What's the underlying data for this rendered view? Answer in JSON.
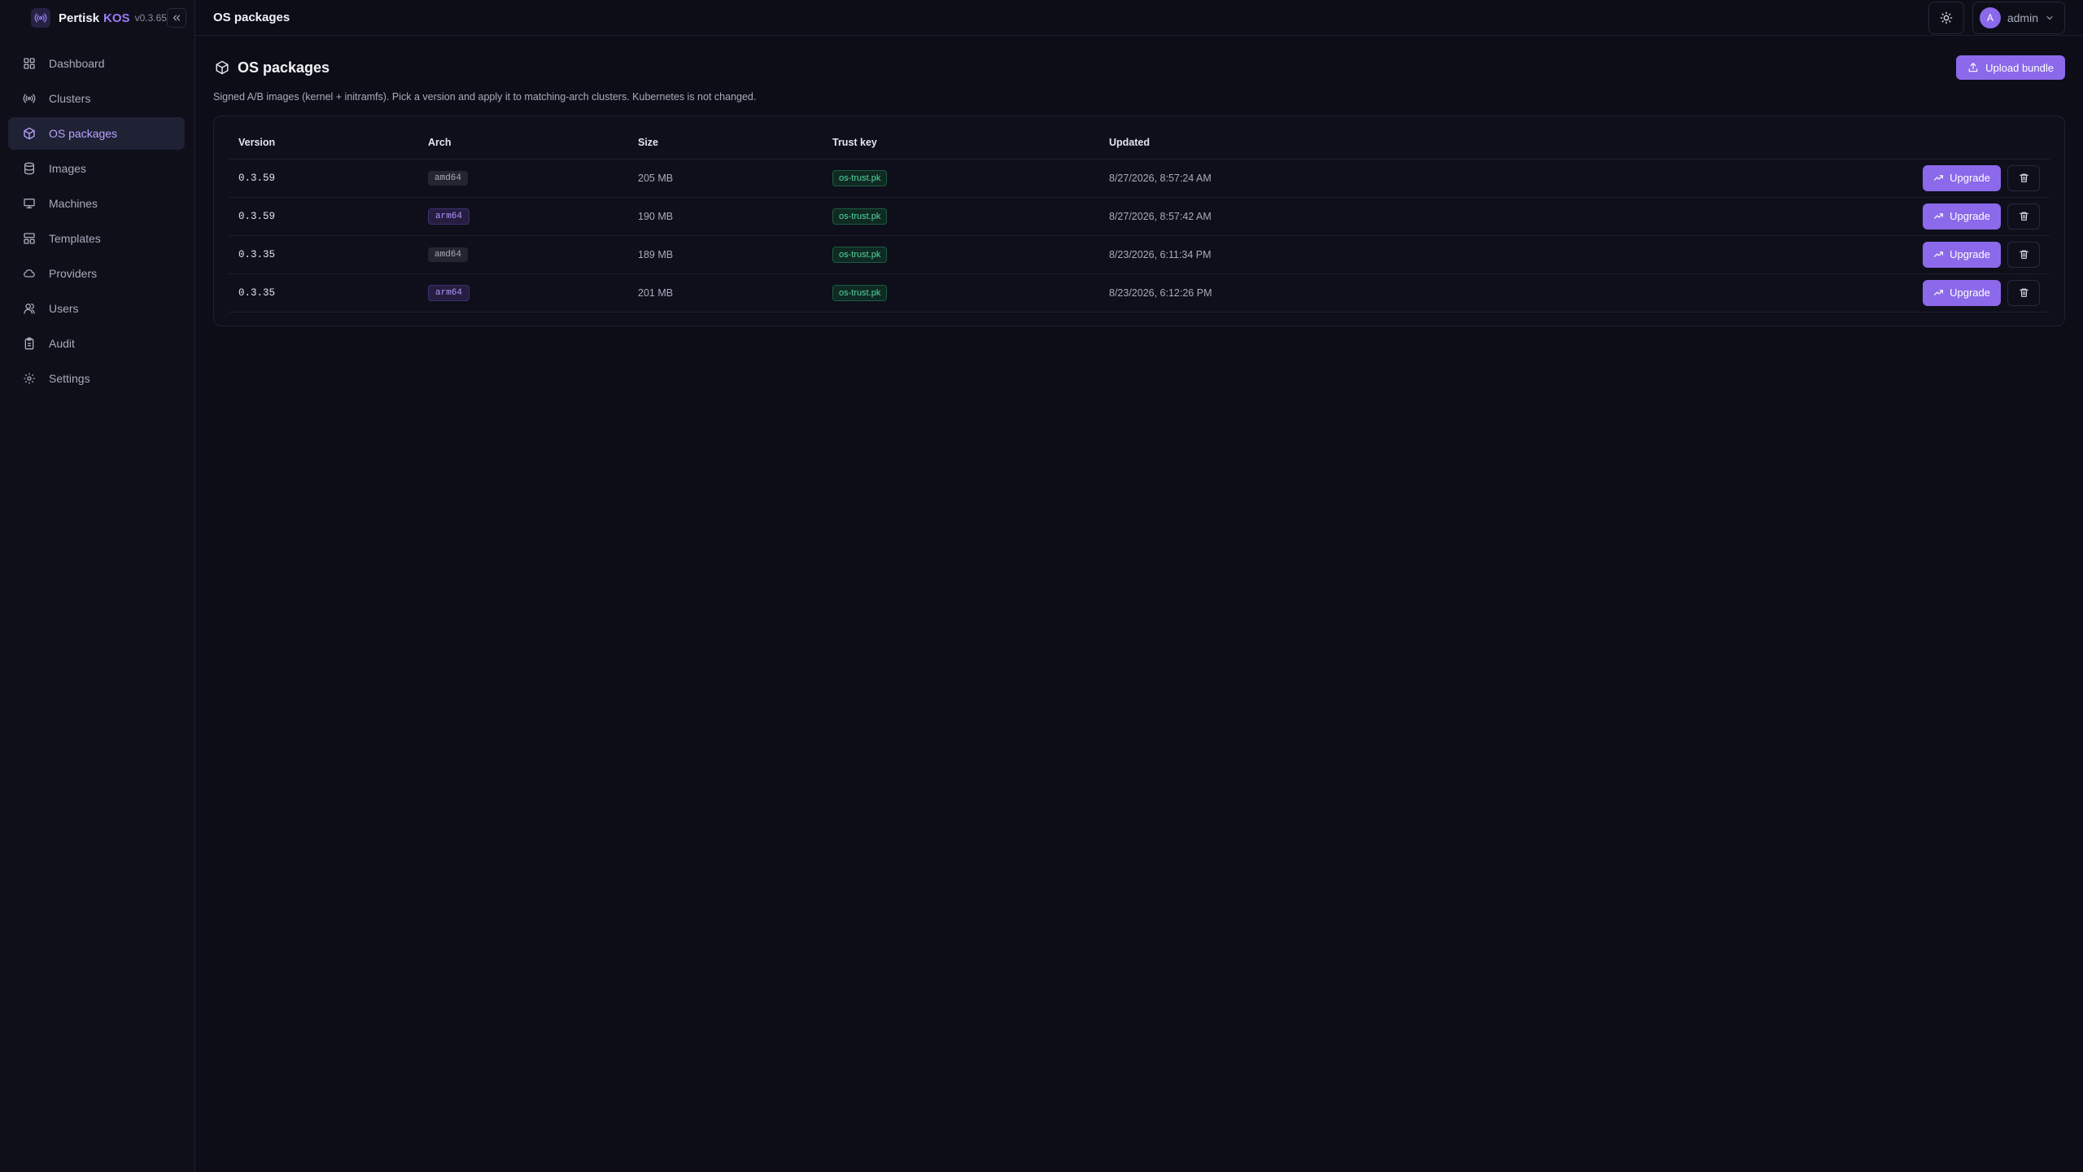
{
  "brand": {
    "name": "Pertisk",
    "accent": "KOS",
    "version": "v0.3.65"
  },
  "sidebar": {
    "items": [
      {
        "label": "Dashboard",
        "icon": "grid-icon"
      },
      {
        "label": "Clusters",
        "icon": "broadcast-icon"
      },
      {
        "label": "OS packages",
        "icon": "package-icon",
        "active": true
      },
      {
        "label": "Images",
        "icon": "database-icon"
      },
      {
        "label": "Machines",
        "icon": "monitor-icon"
      },
      {
        "label": "Templates",
        "icon": "layout-icon"
      },
      {
        "label": "Providers",
        "icon": "cloud-icon"
      },
      {
        "label": "Users",
        "icon": "users-icon"
      },
      {
        "label": "Audit",
        "icon": "clipboard-icon"
      },
      {
        "label": "Settings",
        "icon": "gear-icon"
      }
    ]
  },
  "topbar": {
    "title": "OS packages",
    "user": {
      "initial": "A",
      "name": "admin"
    }
  },
  "page": {
    "title": "OS packages",
    "description": "Signed A/B images (kernel + initramfs). Pick a version and apply it to matching-arch clusters. Kubernetes is not changed.",
    "upload_label": "Upload bundle"
  },
  "table": {
    "headers": {
      "version": "Version",
      "arch": "Arch",
      "size": "Size",
      "trust": "Trust key",
      "updated": "Updated"
    },
    "upgrade_label": "Upgrade",
    "rows": [
      {
        "version": "0.3.59",
        "arch": "amd64",
        "size": "205 MB",
        "trust": "os-trust.pk",
        "updated": "8/27/2026, 8:57:24 AM"
      },
      {
        "version": "0.3.59",
        "arch": "arm64",
        "size": "190 MB",
        "trust": "os-trust.pk",
        "updated": "8/27/2026, 8:57:42 AM"
      },
      {
        "version": "0.3.35",
        "arch": "amd64",
        "size": "189 MB",
        "trust": "os-trust.pk",
        "updated": "8/23/2026, 6:11:34 PM"
      },
      {
        "version": "0.3.35",
        "arch": "arm64",
        "size": "201 MB",
        "trust": "os-trust.pk",
        "updated": "8/23/2026, 6:12:26 PM"
      }
    ]
  },
  "colors": {
    "accent": "#8b69ea",
    "background": "#0c0d16",
    "trust_green": "#54d6a0"
  }
}
